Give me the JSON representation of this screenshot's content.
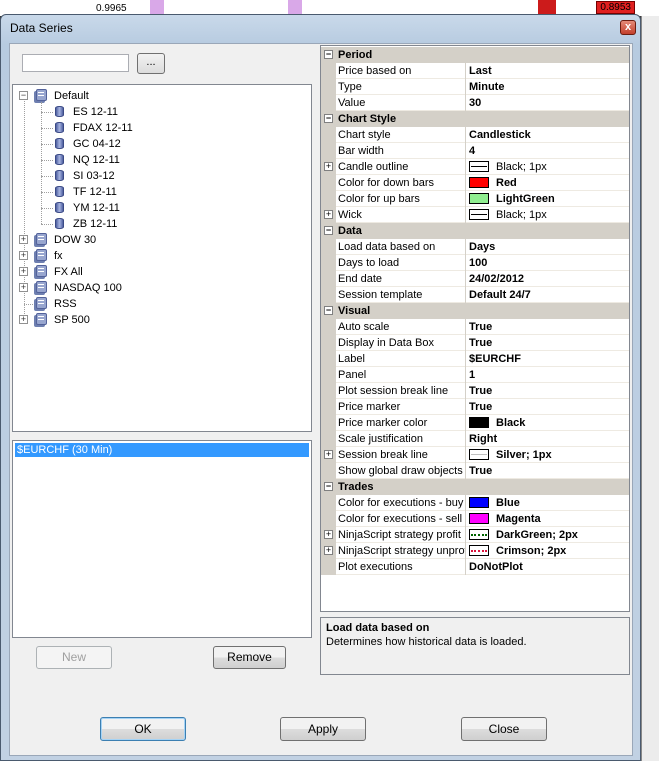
{
  "background": {
    "left_price": "0.9965",
    "right_price": "0.8953"
  },
  "window": {
    "title": "Data Series",
    "close_glyph": "x"
  },
  "instrument_search": {
    "value": "",
    "browse_label": "..."
  },
  "tree": [
    {
      "label": "Default",
      "expanded": true,
      "children": [
        "ES 12-11",
        "FDAX 12-11",
        "GC 04-12",
        "NQ 12-11",
        "SI 03-12",
        "TF 12-11",
        "YM 12-11",
        "ZB 12-11"
      ]
    },
    {
      "label": "DOW 30",
      "expanded": false
    },
    {
      "label": "fx",
      "expanded": false
    },
    {
      "label": "FX All",
      "expanded": false
    },
    {
      "label": "NASDAQ 100",
      "expanded": false
    },
    {
      "label": "RSS",
      "expanded": null
    },
    {
      "label": "SP 500",
      "expanded": false
    }
  ],
  "series_list": {
    "items": [
      "$EURCHF (30 Min)"
    ],
    "new_label": "New",
    "remove_label": "Remove"
  },
  "properties": [
    {
      "category": "Period",
      "rows": [
        {
          "name": "Price based on",
          "value": "Last"
        },
        {
          "name": "Type",
          "value": "Minute"
        },
        {
          "name": "Value",
          "value": "30"
        }
      ]
    },
    {
      "category": "Chart Style",
      "rows": [
        {
          "name": "Chart style",
          "value": "Candlestick"
        },
        {
          "name": "Bar width",
          "value": "4"
        },
        {
          "name": "Candle outline",
          "value": "Black; 1px",
          "swatch": "line",
          "color": "#000000",
          "expandable": true,
          "bold": false
        },
        {
          "name": "Color for down bars",
          "value": "Red",
          "swatch": "fill",
          "color": "#ff0000"
        },
        {
          "name": "Color for up bars",
          "value": "LightGreen",
          "swatch": "fill",
          "color": "#90ee90"
        },
        {
          "name": "Wick",
          "value": "Black; 1px",
          "swatch": "line",
          "color": "#000000",
          "expandable": true,
          "bold": false
        }
      ]
    },
    {
      "category": "Data",
      "rows": [
        {
          "name": "Load data based on",
          "value": "Days"
        },
        {
          "name": "Days to load",
          "value": "100"
        },
        {
          "name": "End date",
          "value": "24/02/2012"
        },
        {
          "name": "Session template",
          "value": "Default 24/7"
        }
      ]
    },
    {
      "category": "Visual",
      "rows": [
        {
          "name": "Auto scale",
          "value": "True"
        },
        {
          "name": "Display in Data Box",
          "value": "True"
        },
        {
          "name": "Label",
          "value": "$EURCHF"
        },
        {
          "name": "Panel",
          "value": "1"
        },
        {
          "name": "Plot session break line",
          "value": "True"
        },
        {
          "name": "Price marker",
          "value": "True"
        },
        {
          "name": "Price marker color",
          "value": "Black",
          "swatch": "fill",
          "color": "#000000"
        },
        {
          "name": "Scale justification",
          "value": "Right"
        },
        {
          "name": "Session break line",
          "value": "Silver; 1px",
          "swatch": "line",
          "color": "#c0c0c0",
          "expandable": true
        },
        {
          "name": "Show global draw objects",
          "value": "True"
        }
      ]
    },
    {
      "category": "Trades",
      "rows": [
        {
          "name": "Color for executions - buy",
          "value": "Blue",
          "swatch": "fill",
          "color": "#0000ff"
        },
        {
          "name": "Color for executions - sell",
          "value": "Magenta",
          "swatch": "fill",
          "color": "#ff00ff"
        },
        {
          "name": "NinjaScript strategy profit",
          "value": "DarkGreen; 2px",
          "swatch": "dot",
          "color": "#006400",
          "expandable": true
        },
        {
          "name": "NinjaScript strategy unprofitable",
          "value": "Crimson; 2px",
          "swatch": "dot",
          "color": "#dc143c",
          "expandable": true
        },
        {
          "name": "Plot executions",
          "value": "DoNotPlot"
        }
      ]
    }
  ],
  "description": {
    "title": "Load data based on",
    "text": "Determines how historical data is loaded."
  },
  "buttons": {
    "ok": "OK",
    "apply": "Apply",
    "close": "Close"
  }
}
